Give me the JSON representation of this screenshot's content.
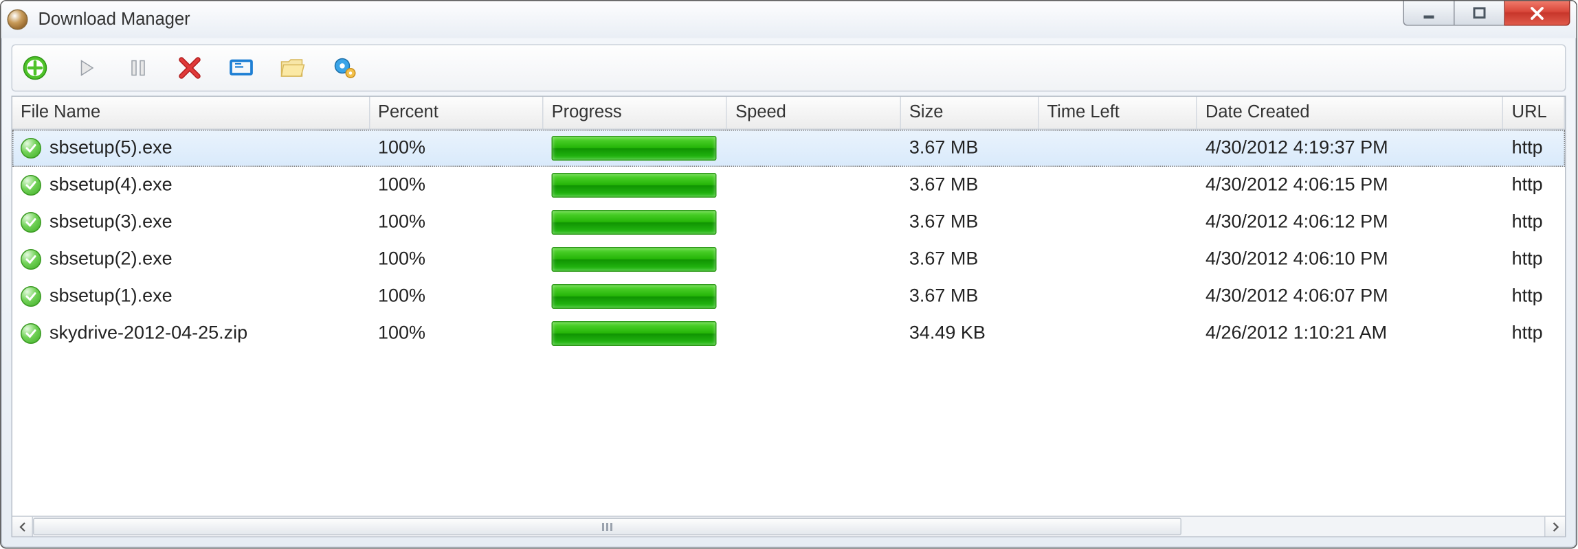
{
  "window": {
    "title": "Download Manager"
  },
  "toolbar": {
    "add": "add-icon",
    "play": "play-icon",
    "pause": "pause-icon",
    "delete": "delete-icon",
    "screen": "screen-icon",
    "folder": "folder-icon",
    "settings": "settings-icon"
  },
  "columns": [
    "File Name",
    "Percent",
    "Progress",
    "Speed",
    "Size",
    "Time Left",
    "Date Created",
    "URL"
  ],
  "downloads": [
    {
      "filename": "sbsetup(5).exe",
      "percent": "100%",
      "progress": 100,
      "speed": "",
      "size": "3.67 MB",
      "time_left": "",
      "date_created": "4/30/2012 4:19:37 PM",
      "url": "http",
      "selected": true
    },
    {
      "filename": "sbsetup(4).exe",
      "percent": "100%",
      "progress": 100,
      "speed": "",
      "size": "3.67 MB",
      "time_left": "",
      "date_created": "4/30/2012 4:06:15 PM",
      "url": "http",
      "selected": false
    },
    {
      "filename": "sbsetup(3).exe",
      "percent": "100%",
      "progress": 100,
      "speed": "",
      "size": "3.67 MB",
      "time_left": "",
      "date_created": "4/30/2012 4:06:12 PM",
      "url": "http",
      "selected": false
    },
    {
      "filename": "sbsetup(2).exe",
      "percent": "100%",
      "progress": 100,
      "speed": "",
      "size": "3.67 MB",
      "time_left": "",
      "date_created": "4/30/2012 4:06:10 PM",
      "url": "http",
      "selected": false
    },
    {
      "filename": "sbsetup(1).exe",
      "percent": "100%",
      "progress": 100,
      "speed": "",
      "size": "3.67 MB",
      "time_left": "",
      "date_created": "4/30/2012 4:06:07 PM",
      "url": "http",
      "selected": false
    },
    {
      "filename": "skydrive-2012-04-25.zip",
      "percent": "100%",
      "progress": 100,
      "speed": "",
      "size": "34.49 KB",
      "time_left": "",
      "date_created": "4/26/2012 1:10:21 AM",
      "url": "http",
      "selected": false
    }
  ]
}
